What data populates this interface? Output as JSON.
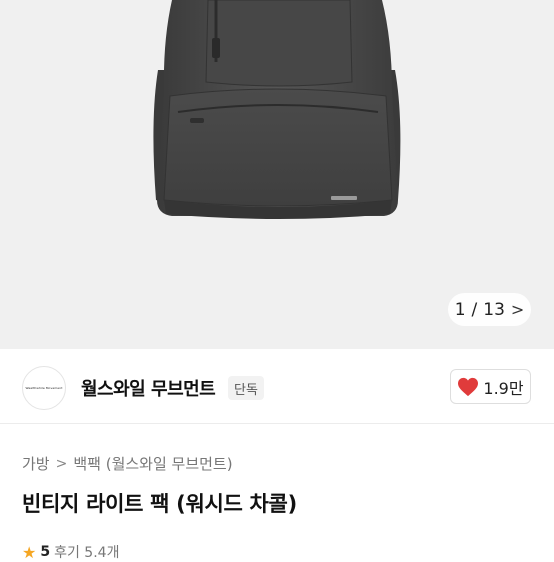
{
  "gallery": {
    "current": "1",
    "separator": "/",
    "total": "13",
    "chevron": ">"
  },
  "shop": {
    "logo_text": "Wealthwhile Movement",
    "name": "월스와일 무브먼트",
    "badge": "단독"
  },
  "like": {
    "count": "1.9만",
    "heart_color": "#e03b3b"
  },
  "breadcrumb": {
    "items": [
      "가방",
      "백팩 (월스와일 무브먼트)"
    ],
    "separator": ">"
  },
  "product": {
    "title": "빈티지 라이트 팩 (워시드 차콜)"
  },
  "rating": {
    "score": "5",
    "label": "후기 5.4개"
  },
  "icons": {
    "heart": "heart-icon",
    "chevron": "chevron-right-icon",
    "star": "star-icon"
  }
}
